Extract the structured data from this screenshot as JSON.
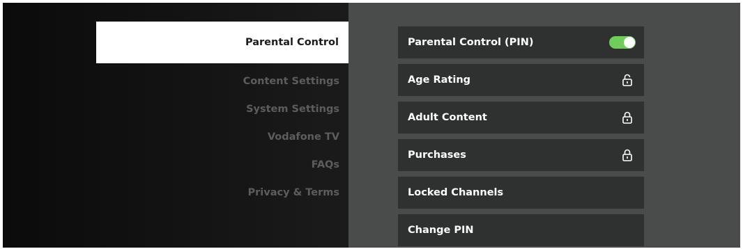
{
  "menu": {
    "selected": "Parental Control",
    "items": [
      "Content Settings",
      "System Settings",
      "Vodafone TV",
      "FAQs",
      "Privacy & Terms"
    ]
  },
  "settings": [
    {
      "label": "Parental Control (PIN)",
      "control": "toggle",
      "state": "on"
    },
    {
      "label": "Age Rating",
      "control": "lock",
      "state": "unlocked"
    },
    {
      "label": "Adult Content",
      "control": "lock",
      "state": "locked"
    },
    {
      "label": "Purchases",
      "control": "lock",
      "state": "locked"
    },
    {
      "label": "Locked Channels",
      "control": "none"
    },
    {
      "label": "Change PIN",
      "control": "none"
    }
  ],
  "colors": {
    "toggle_on": "#6fcd5a",
    "row_background": "#2f3131",
    "panel_background": "#4a4c4c"
  }
}
